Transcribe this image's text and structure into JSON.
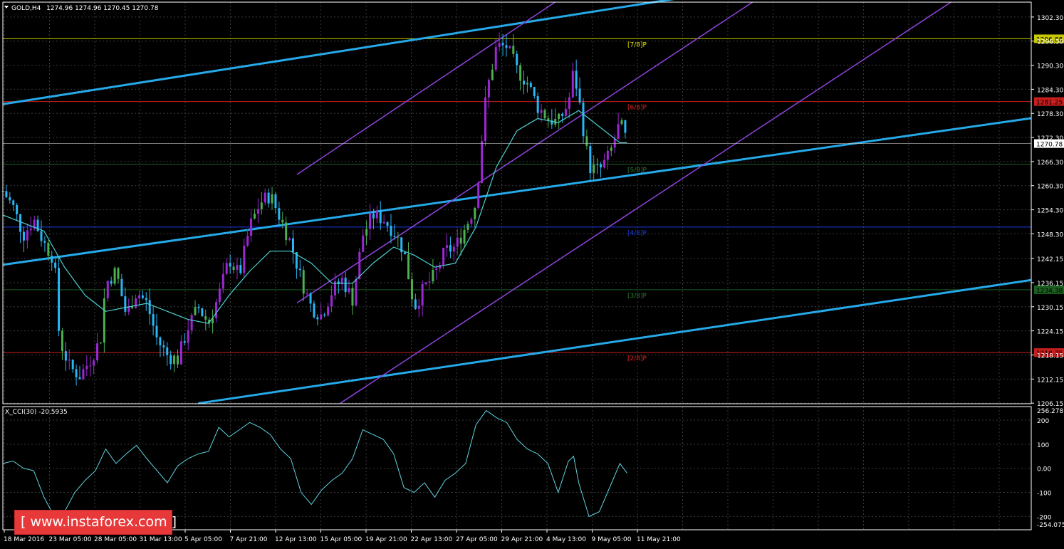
{
  "header": {
    "symbol_label": "GOLD,H4",
    "ohlc_text": "1274.96 1274.96 1270.45 1270.78"
  },
  "indicator": {
    "label": "X_CCI(30) -20.5935"
  },
  "brand": {
    "text": "[ www.instaforex.com ]"
  },
  "colors": {
    "background": "#000000",
    "grid": "#3a3a3a",
    "bull_candle": "#9c27d4",
    "bear_candle": "#29b6f6",
    "neutral_candle": "#4caf50",
    "ma": "#4dd0d0",
    "regression": "#26a9e8",
    "pitchfork": "#8e44dd",
    "cci": "#5fd3e0",
    "axis_text": "#ffffff"
  },
  "chart_data": [
    {
      "type": "candlestick",
      "symbol": "GOLD",
      "timeframe": "H4",
      "last_price": 1270.78,
      "x_tick_labels": [
        "18 Mar 2016",
        "23 Mar 05:00",
        "28 Mar 05:00",
        "31 Mar 13:00",
        "5 Apr 05:00",
        "7 Apr 21:00",
        "12 Apr 13:00",
        "15 Apr 05:00",
        "19 Apr 21:00",
        "22 Apr 13:00",
        "27 Apr 05:00",
        "29 Apr 21:00",
        "4 May 13:00",
        "9 May 05:00",
        "11 May 21:00"
      ],
      "y_ticks": [
        1206.15,
        1212.15,
        1218.15,
        1224.15,
        1230.15,
        1236.15,
        1242.15,
        1248.3,
        1254.3,
        1260.3,
        1266.3,
        1272.3,
        1278.3,
        1284.3,
        1290.3,
        1296.3,
        1302.3
      ],
      "y_tick_labels": [
        "1206.15",
        "1212.15",
        "1218.15",
        "1224.15",
        "1230.15",
        "1236.15",
        "1242.15",
        "1248.30",
        "1254.30",
        "1260.30",
        "1266.30",
        "1272.30",
        "1278.30",
        "1284.30",
        "1290.30",
        "1296.30",
        "1302.30"
      ],
      "ylim": [
        1206,
        1306
      ],
      "murrey_levels": [
        {
          "label": "[7/8]P",
          "value": 1296.88,
          "price_label": "1296.88",
          "color": "#e6e600",
          "line": "#c8c800"
        },
        {
          "label": "[6/8]P",
          "value": 1281.25,
          "price_label": "1281.25",
          "color": "#e02020",
          "line": "#c81e1e"
        },
        {
          "label": "[5/8]P",
          "value": 1265.63,
          "price_label": "",
          "color": "#2e7d32",
          "line": "#1b5e20"
        },
        {
          "label": "[4/8]P",
          "value": 1250.0,
          "price_label": "",
          "color": "#1a3ce0",
          "line": "#1a3ce0"
        },
        {
          "label": "[3/8]P",
          "value": 1234.38,
          "price_label": "1234.38",
          "color": "#2e7d32",
          "line": "#1b5e20"
        },
        {
          "label": "[2/8]P",
          "value": 1218.75,
          "price_label": "1218.75",
          "color": "#e02020",
          "line": "#c81e1e"
        }
      ],
      "regression_channel": {
        "upper": {
          "x_start": 0.0,
          "y_start": 1280.6,
          "x_end": 0.663,
          "y_end": 1307.2
        },
        "middle": {
          "x_start": 0.0,
          "y_start": 1240.6,
          "x_end": 1.0,
          "y_end": 1277.1
        },
        "lower": {
          "x_start": 0.19,
          "y_start": 1206.1,
          "x_end": 1.0,
          "y_end": 1236.8
        }
      },
      "pitchfork": {
        "upper": {
          "x_start": 0.286,
          "y_start": 1263.1,
          "x_end": 0.537,
          "y_end": 1306.0
        },
        "middle": {
          "x_start": 0.286,
          "y_start": 1231.1,
          "x_end": 0.729,
          "y_end": 1306.0
        },
        "lower": {
          "x_start": 0.328,
          "y_start": 1206.1,
          "x_end": 0.922,
          "y_end": 1306.0
        }
      },
      "close_path": [
        [
          0.0,
          1259
        ],
        [
          0.01,
          1255
        ],
        [
          0.02,
          1248
        ],
        [
          0.03,
          1252
        ],
        [
          0.04,
          1246
        ],
        [
          0.05,
          1242
        ],
        [
          0.055,
          1222
        ],
        [
          0.065,
          1215
        ],
        [
          0.075,
          1213
        ],
        [
          0.085,
          1217
        ],
        [
          0.095,
          1222
        ],
        [
          0.1,
          1236
        ],
        [
          0.11,
          1239
        ],
        [
          0.12,
          1228
        ],
        [
          0.13,
          1234
        ],
        [
          0.14,
          1231
        ],
        [
          0.15,
          1222
        ],
        [
          0.16,
          1218
        ],
        [
          0.17,
          1217
        ],
        [
          0.18,
          1225
        ],
        [
          0.19,
          1230
        ],
        [
          0.2,
          1226
        ],
        [
          0.21,
          1233
        ],
        [
          0.22,
          1242
        ],
        [
          0.23,
          1238
        ],
        [
          0.24,
          1250
        ],
        [
          0.25,
          1256
        ],
        [
          0.26,
          1258
        ],
        [
          0.27,
          1252
        ],
        [
          0.28,
          1246
        ],
        [
          0.29,
          1237
        ],
        [
          0.3,
          1230
        ],
        [
          0.31,
          1228
        ],
        [
          0.32,
          1234
        ],
        [
          0.33,
          1237
        ],
        [
          0.34,
          1232
        ],
        [
          0.35,
          1248
        ],
        [
          0.36,
          1253
        ],
        [
          0.37,
          1252
        ],
        [
          0.38,
          1249
        ],
        [
          0.39,
          1244
        ],
        [
          0.4,
          1230
        ],
        [
          0.41,
          1235
        ],
        [
          0.42,
          1238
        ],
        [
          0.43,
          1244
        ],
        [
          0.44,
          1245
        ],
        [
          0.45,
          1250
        ],
        [
          0.46,
          1256
        ],
        [
          0.465,
          1270
        ],
        [
          0.47,
          1283
        ],
        [
          0.48,
          1295
        ],
        [
          0.49,
          1295
        ],
        [
          0.5,
          1289
        ],
        [
          0.51,
          1286
        ],
        [
          0.52,
          1280
        ],
        [
          0.53,
          1277
        ],
        [
          0.54,
          1276
        ],
        [
          0.55,
          1281
        ],
        [
          0.555,
          1289
        ],
        [
          0.56,
          1282
        ],
        [
          0.57,
          1265
        ],
        [
          0.58,
          1264
        ],
        [
          0.59,
          1268
        ],
        [
          0.6,
          1276
        ],
        [
          0.607,
          1271
        ]
      ],
      "ma_path": [
        [
          0.0,
          1253
        ],
        [
          0.02,
          1251
        ],
        [
          0.04,
          1249
        ],
        [
          0.06,
          1240
        ],
        [
          0.08,
          1233
        ],
        [
          0.1,
          1229
        ],
        [
          0.12,
          1230
        ],
        [
          0.14,
          1231
        ],
        [
          0.16,
          1229
        ],
        [
          0.18,
          1227
        ],
        [
          0.2,
          1226
        ],
        [
          0.22,
          1233
        ],
        [
          0.24,
          1239
        ],
        [
          0.26,
          1244
        ],
        [
          0.28,
          1244
        ],
        [
          0.3,
          1241
        ],
        [
          0.32,
          1236
        ],
        [
          0.34,
          1236
        ],
        [
          0.36,
          1241
        ],
        [
          0.38,
          1245
        ],
        [
          0.4,
          1243
        ],
        [
          0.42,
          1240
        ],
        [
          0.44,
          1241
        ],
        [
          0.46,
          1250
        ],
        [
          0.48,
          1265
        ],
        [
          0.5,
          1274
        ],
        [
          0.52,
          1277
        ],
        [
          0.54,
          1276
        ],
        [
          0.56,
          1279
        ],
        [
          0.58,
          1275
        ],
        [
          0.6,
          1271
        ],
        [
          0.607,
          1271
        ]
      ],
      "cci": {
        "ylim": [
          -255,
          256
        ],
        "y_ticks": [
          200,
          100,
          0,
          -100,
          -200
        ],
        "y_tick_labels": [
          "200",
          "100",
          "0.00",
          "-100",
          "-200"
        ],
        "max_label": "256.278",
        "min_label": "-254.0753",
        "last_value": -20.5935,
        "path": [
          [
            0.0,
            20
          ],
          [
            0.01,
            30
          ],
          [
            0.02,
            0
          ],
          [
            0.03,
            -10
          ],
          [
            0.04,
            -120
          ],
          [
            0.05,
            -200
          ],
          [
            0.06,
            -180
          ],
          [
            0.07,
            -100
          ],
          [
            0.08,
            -50
          ],
          [
            0.09,
            -10
          ],
          [
            0.1,
            80
          ],
          [
            0.11,
            20
          ],
          [
            0.12,
            60
          ],
          [
            0.13,
            95
          ],
          [
            0.14,
            40
          ],
          [
            0.15,
            -10
          ],
          [
            0.16,
            -60
          ],
          [
            0.17,
            10
          ],
          [
            0.18,
            40
          ],
          [
            0.19,
            60
          ],
          [
            0.2,
            70
          ],
          [
            0.21,
            170
          ],
          [
            0.22,
            130
          ],
          [
            0.23,
            160
          ],
          [
            0.24,
            190
          ],
          [
            0.25,
            170
          ],
          [
            0.26,
            140
          ],
          [
            0.27,
            80
          ],
          [
            0.28,
            40
          ],
          [
            0.29,
            -100
          ],
          [
            0.3,
            -150
          ],
          [
            0.31,
            -90
          ],
          [
            0.32,
            -50
          ],
          [
            0.33,
            -20
          ],
          [
            0.34,
            40
          ],
          [
            0.35,
            160
          ],
          [
            0.36,
            140
          ],
          [
            0.37,
            120
          ],
          [
            0.38,
            60
          ],
          [
            0.39,
            -80
          ],
          [
            0.4,
            -100
          ],
          [
            0.41,
            -60
          ],
          [
            0.42,
            -120
          ],
          [
            0.43,
            -50
          ],
          [
            0.44,
            -20
          ],
          [
            0.45,
            20
          ],
          [
            0.46,
            180
          ],
          [
            0.47,
            240
          ],
          [
            0.48,
            210
          ],
          [
            0.49,
            190
          ],
          [
            0.5,
            120
          ],
          [
            0.51,
            80
          ],
          [
            0.52,
            60
          ],
          [
            0.53,
            20
          ],
          [
            0.54,
            -100
          ],
          [
            0.55,
            30
          ],
          [
            0.555,
            50
          ],
          [
            0.56,
            -60
          ],
          [
            0.57,
            -200
          ],
          [
            0.58,
            -180
          ],
          [
            0.59,
            -80
          ],
          [
            0.6,
            20
          ],
          [
            0.607,
            -20
          ]
        ]
      }
    }
  ]
}
